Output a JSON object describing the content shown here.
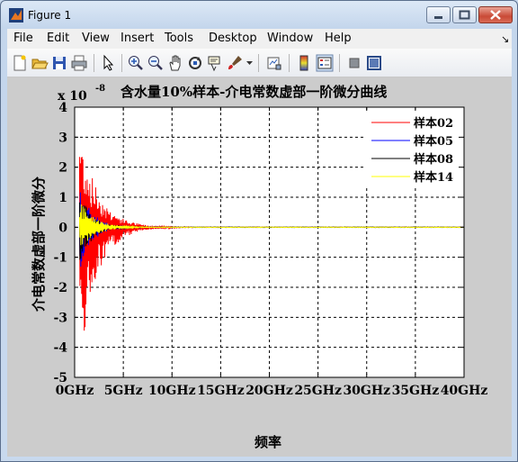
{
  "window": {
    "title": "Figure 1"
  },
  "menu": {
    "items": [
      "File",
      "Edit",
      "View",
      "Insert",
      "Tools",
      "Desktop",
      "Window",
      "Help"
    ],
    "dock_glyph": "↘"
  },
  "toolbar": {
    "icons": [
      "new-figure-icon",
      "open-icon",
      "save-icon",
      "print-icon",
      "edit-plot-icon",
      "zoom-in-icon",
      "zoom-out-icon",
      "pan-icon",
      "rotate-icon",
      "data-cursor-icon",
      "brush-icon",
      "link-icon",
      "colorbar-icon",
      "legend-icon",
      "hide-plot-tools-icon",
      "show-plot-tools-icon"
    ]
  },
  "colors": {
    "red": "#ff0000",
    "blue": "#0000ff",
    "black": "#000000",
    "yellow": "#ffff00"
  },
  "chart_data": {
    "type": "line",
    "title": "含水量10%样本-介电常数虚部一阶微分曲线",
    "xlabel": "频率",
    "ylabel": "介电常数虚部一阶微分",
    "y_exponent": "x 10",
    "y_exponent_power": "-8",
    "xlim": [
      0,
      40
    ],
    "ylim": [
      -5,
      4
    ],
    "x_ticks": [
      "0GHz",
      "5GHz",
      "10GHz",
      "15GHz",
      "20GHz",
      "25GHz",
      "30GHz",
      "35GHz",
      "40GHz"
    ],
    "y_ticks": [
      "-5",
      "-4",
      "-3",
      "-2",
      "-1",
      "0",
      "1",
      "2",
      "3",
      "4"
    ],
    "grid": true,
    "legend_position": "top-right",
    "series": [
      {
        "name": "样本02",
        "color": "#ff0000",
        "peak_pos": 3.5,
        "peak_neg": -4.7,
        "decay_ghz": 1.8
      },
      {
        "name": "样本05",
        "color": "#0000ff",
        "peak_pos": 1.5,
        "peak_neg": -1.5,
        "decay_ghz": 1.2
      },
      {
        "name": "样本08",
        "color": "#000000",
        "peak_pos": 1.2,
        "peak_neg": -1.3,
        "decay_ghz": 1.2
      },
      {
        "name": "样本14",
        "color": "#ffff00",
        "peak_pos": 0.9,
        "peak_neg": -0.8,
        "decay_ghz": 1.5
      }
    ]
  }
}
